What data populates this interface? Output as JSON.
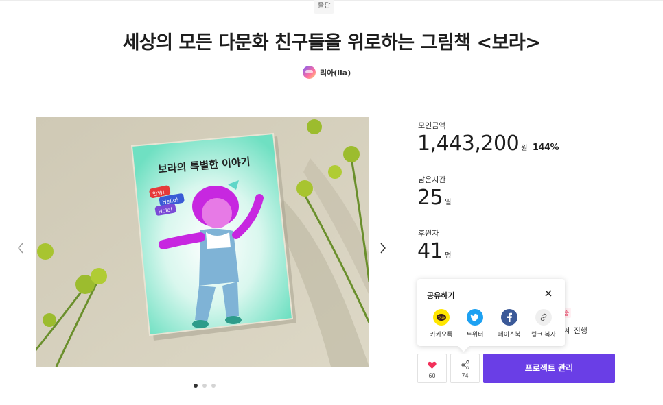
{
  "category": "출판",
  "title": "세상의 모든 다문화 친구들을 위로하는 그림책 <보라>",
  "creator": {
    "name": "리아(lia)"
  },
  "image": {
    "book_title": "보라의 특별한 이야기",
    "bubble_1": "안녕!",
    "bubble_2": "Hello!",
    "bubble_3": "Hola!",
    "slide_count": 3,
    "active_slide": 1
  },
  "stats": {
    "raised_label": "모인금액",
    "raised_value": "1,443,200",
    "raised_unit": "원",
    "raised_percent": "144%",
    "remaining_label": "남은시간",
    "remaining_value": "25",
    "remaining_unit": "일",
    "backers_label": "후원자",
    "backers_value": "41",
    "backers_unit": "명"
  },
  "behind": {
    "badge": "중",
    "text": "제 진행"
  },
  "share_popup": {
    "title": "공유하기",
    "items": [
      {
        "label": "카카오톡",
        "icon": "kakaotalk-icon",
        "color": "#ffe600"
      },
      {
        "label": "트위터",
        "icon": "twitter-icon",
        "color": "#1da1f2"
      },
      {
        "label": "페이스북",
        "icon": "facebook-icon",
        "color": "#3b5998"
      },
      {
        "label": "링크 복사",
        "icon": "link-icon",
        "color": "#efefef"
      }
    ]
  },
  "actions": {
    "like_count": "60",
    "share_count": "74",
    "manage_label": "프로젝트 관리"
  },
  "colors": {
    "accent": "#6a3ee6",
    "heart": "#f2305a"
  }
}
